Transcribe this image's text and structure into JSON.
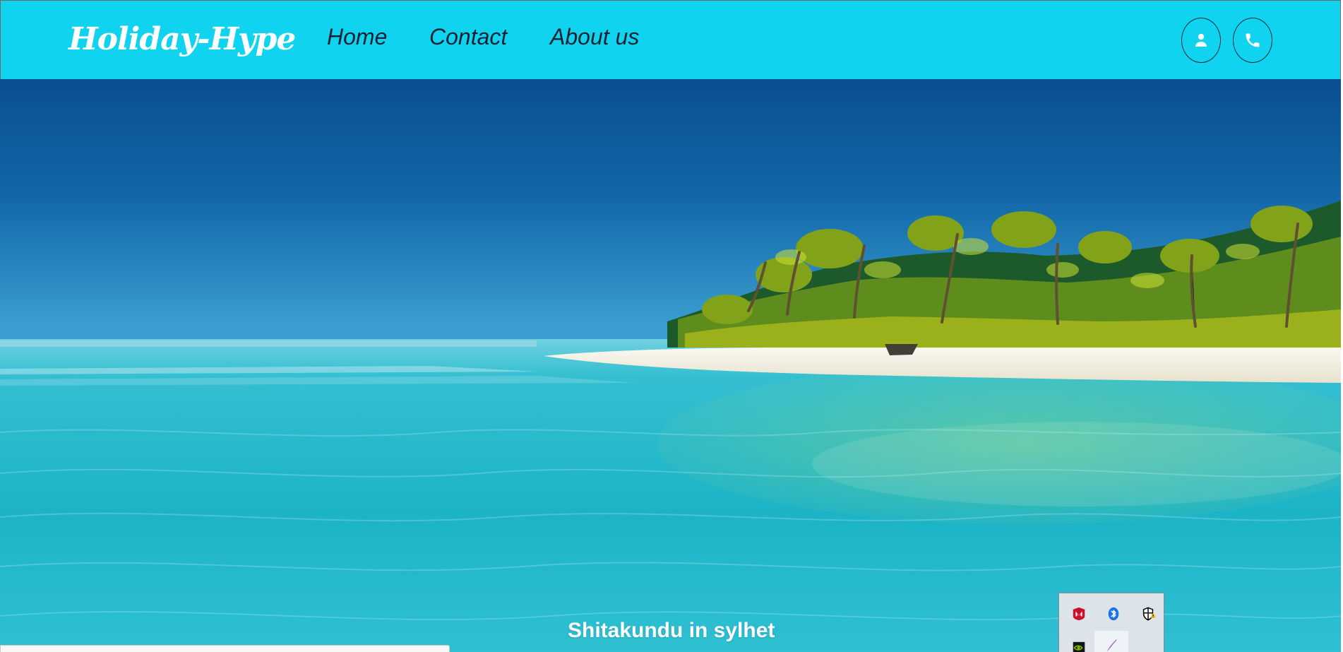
{
  "navbar": {
    "brand": "Holiday-Hype",
    "links": [
      {
        "label": "Home"
      },
      {
        "label": "Contact"
      },
      {
        "label": "About us"
      }
    ],
    "buttons": [
      {
        "icon": "user-icon"
      },
      {
        "icon": "phone-icon"
      }
    ],
    "background_color": "#10d3ef"
  },
  "hero": {
    "caption": "Shitakundu in sylhet"
  },
  "tray": {
    "icons": [
      "mcafee-icon",
      "bluetooth-icon",
      "security-icon",
      "nvidia-icon",
      "pen-icon"
    ]
  }
}
